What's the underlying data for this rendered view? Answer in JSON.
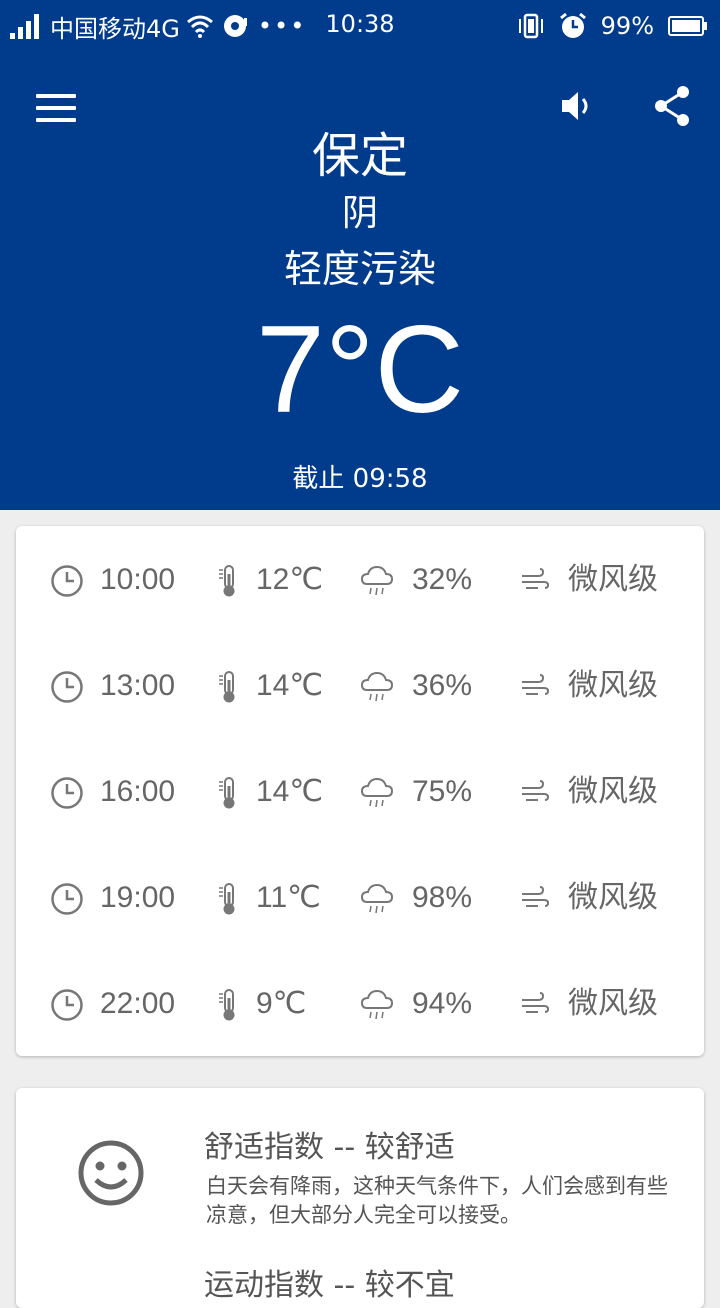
{
  "status_bar": {
    "carrier": "中国移动4G",
    "time": "10:38",
    "battery": "99%",
    "icons": [
      "signal-icon",
      "wifi-icon",
      "sync-icon",
      "more-icon",
      "vibrate-icon",
      "alarm-icon",
      "battery-icon"
    ]
  },
  "header": {
    "city": "保定",
    "weather": "阴",
    "aqi": "轻度污染",
    "temperature": "7°C",
    "update_time": "截止 09:58",
    "menu_icon": "hamburger-menu-icon",
    "sound_icon": "speaker-icon",
    "share_icon": "share-icon",
    "background_color": "#003b8c"
  },
  "forecast": [
    {
      "time": "10:00",
      "temp": "12℃",
      "precip": "32%",
      "wind": "微风级"
    },
    {
      "time": "13:00",
      "temp": "14℃",
      "precip": "36%",
      "wind": "微风级"
    },
    {
      "time": "16:00",
      "temp": "14℃",
      "precip": "75%",
      "wind": "微风级"
    },
    {
      "time": "19:00",
      "temp": "11℃",
      "precip": "98%",
      "wind": "微风级"
    },
    {
      "time": "22:00",
      "temp": "9℃",
      "precip": "94%",
      "wind": "微风级"
    }
  ],
  "indices": {
    "comfort": {
      "title": "舒适指数 -- 较舒适",
      "description": "白天会有降雨，这种天气条件下，人们会感到有些凉意，但大部分人完全可以接受。",
      "icon": "smiley-face-icon"
    },
    "sport": {
      "title": "运动指数 -- 较不宜"
    }
  }
}
